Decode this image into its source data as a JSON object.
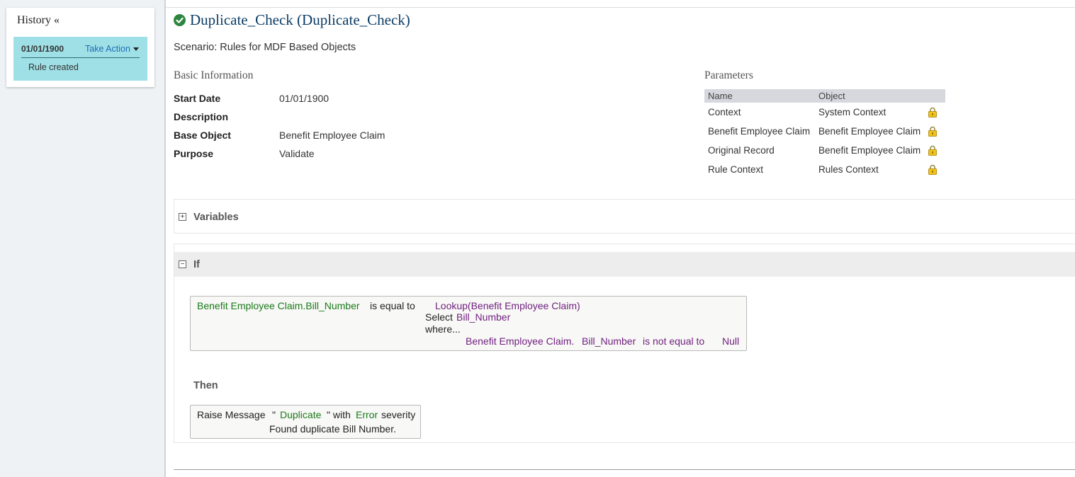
{
  "history": {
    "title": "History «",
    "entry": {
      "date": "01/01/1900",
      "action_label": "Take Action",
      "note": "Rule created"
    }
  },
  "header": {
    "status_icon": "check-circle-icon",
    "title": "Duplicate_Check (Duplicate_Check)",
    "scenario": "Scenario: Rules for MDF Based Objects"
  },
  "basic_info": {
    "title": "Basic Information",
    "rows": [
      {
        "label": "Start Date",
        "value": "01/01/1900"
      },
      {
        "label": "Description",
        "value": ""
      },
      {
        "label": "Base Object",
        "value": "Benefit Employee Claim"
      },
      {
        "label": "Purpose",
        "value": "Validate"
      }
    ]
  },
  "parameters": {
    "title": "Parameters",
    "columns": [
      "Name",
      "Object"
    ],
    "rows": [
      {
        "name": "Context",
        "object": "System Context"
      },
      {
        "name": "Benefit Employee Claim",
        "object": "Benefit Employee Claim"
      },
      {
        "name": "Original Record",
        "object": "Benefit Employee Claim"
      },
      {
        "name": "Rule Context",
        "object": "Rules Context"
      }
    ],
    "lock_icon": "lock-icon"
  },
  "variables": {
    "toggle_glyph": "+",
    "label": "Variables"
  },
  "if_section": {
    "toggle_glyph": "−",
    "label": "If",
    "condition": {
      "left_field": "Benefit Employee Claim.Bill_Number",
      "operator": "is equal to",
      "lookup": "Lookup(Benefit Employee Claim)",
      "select_kw": "Select",
      "select_field": "Bill_Number",
      "where_kw": "where...",
      "where_obj": "Benefit Employee Claim.",
      "where_field": "Bill_Number",
      "where_op": "is not equal to",
      "where_value": "Null"
    },
    "then_label": "Then",
    "action": {
      "prefix": "Raise Message",
      "quote_open": "\"",
      "message_key": "Duplicate",
      "quote_close": "\" with",
      "severity": "Error",
      "severity_suffix": "severity",
      "message_text": "Found duplicate Bill Number."
    }
  },
  "colors": {
    "accent_blue": "#0b3d66",
    "history_highlight": "#9fe0e6",
    "link": "#1f6db3",
    "rule_green": "#1a7a1a",
    "rule_purple": "#6f1f7f",
    "success": "#2e8540"
  }
}
